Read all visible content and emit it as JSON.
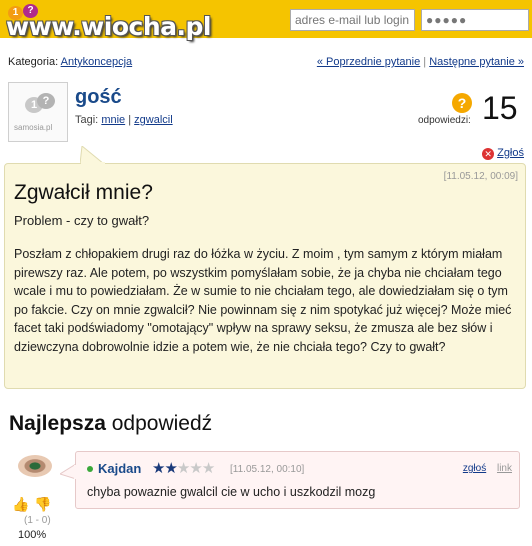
{
  "site": {
    "logo_text": "www.wiocha.pl",
    "logo_bubble_1": "1",
    "logo_bubble_2": "?"
  },
  "login": {
    "email_placeholder": "adres e-mail lub login",
    "password_value": "●●●●●"
  },
  "category": {
    "label": "Kategoria:",
    "name": "Antykoncepcja"
  },
  "nav": {
    "prev": "« Poprzednie pytanie",
    "separator": "|",
    "next": "Następne pytanie »"
  },
  "question": {
    "avatar_text": "samosia.pl",
    "author": "gość",
    "tags_label": "Tagi:",
    "tags": [
      "mnie",
      "zgwalcil"
    ],
    "tags_separator": "|",
    "answers_icon": "?",
    "answers_label": "odpowiedzi:",
    "answers_count": "15",
    "report_label": "Zgłoś",
    "date": "[11.05.12, 00:09]",
    "title": "Zgwałcił mnie?",
    "subtitle": "Problem - czy to gwałt?",
    "body": "Poszłam z chłopakiem drugi raz do łóżka w życiu. Z moim , tym samym z którym miałam pirewszy raz. Ale potem, po wszystkim pomyślałam sobie, że ja chyba nie chciałam tego wcale i mu to powiedziałam. Że w sumie to nie chciałam tego, ale dowiedziałam się o tym po fakcie. Czy on mnie zgwalcił? Nie powinnam się z nim spotykać już więcej? Może mieć facet taki podświadomy \"omotający\" wpływ na sprawy seksu, że zmusza ale bez słów i dziewczyna dobrowolnie idzie a potem wie, że nie chciała tego? Czy to gwałt?"
  },
  "best_answer": {
    "heading_bold": "Najlepsza",
    "heading_rest": "odpowiedź",
    "author": "Kajdan",
    "rating_stars": 1.5,
    "rating_max": 5,
    "date": "[11.05.12, 00:10]",
    "report_label": "zgłoś",
    "link_label": "link",
    "text": "chyba powaznie gwalcil cie w ucho i uszkodzil mozg",
    "votes": "(1 - 0)",
    "percent": "100%"
  },
  "colors": {
    "topbar": "#f5c400",
    "link": "#123a8a",
    "question_bg": "#fbf7dc",
    "answer_bg": "#fff4f4"
  }
}
